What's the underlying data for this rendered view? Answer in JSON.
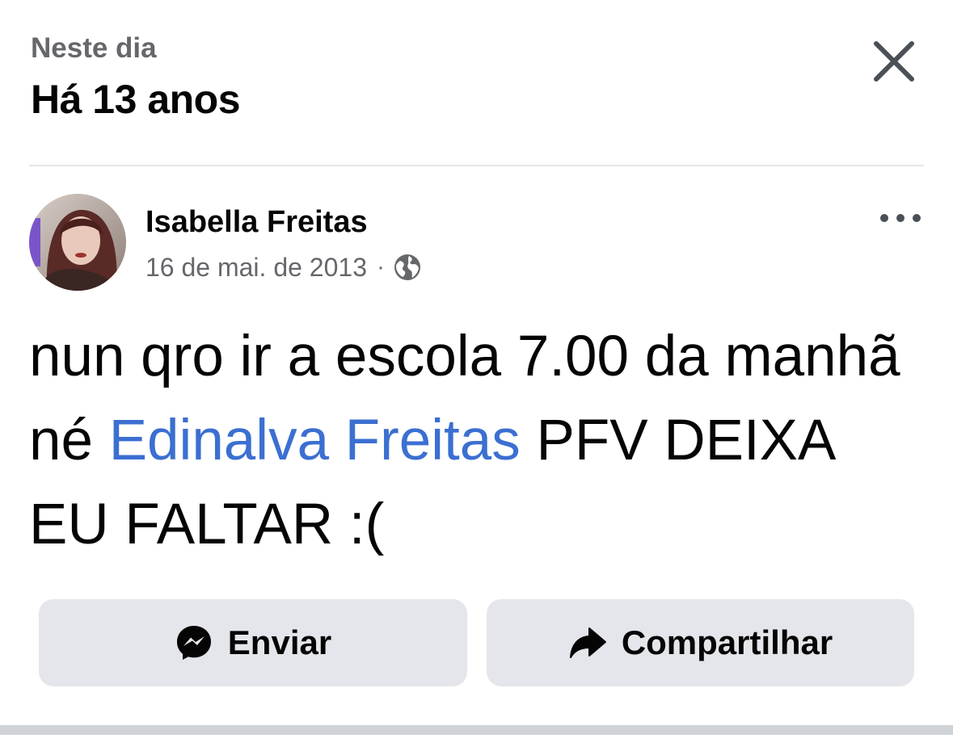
{
  "header": {
    "subtitle": "Neste dia",
    "title": "Há 13 anos"
  },
  "post": {
    "author": "Isabella Freitas",
    "date": "16 de mai. de 2013",
    "separator": "·",
    "privacy_icon": "globe-icon",
    "text_before_mention": "nun qro ir a escola 7.00 da manhã né ",
    "mention": "Edinalva Freitas",
    "text_after_mention": " PFV DEIXA EU FALTAR :("
  },
  "actions": {
    "send_label": "Enviar",
    "send_icon": "messenger-icon",
    "share_label": "Compartilhar",
    "share_icon": "share-arrow-icon"
  },
  "colors": {
    "mention": "#3b6fd1",
    "secondary_text": "#65676b",
    "button_bg": "#e4e6eb"
  }
}
